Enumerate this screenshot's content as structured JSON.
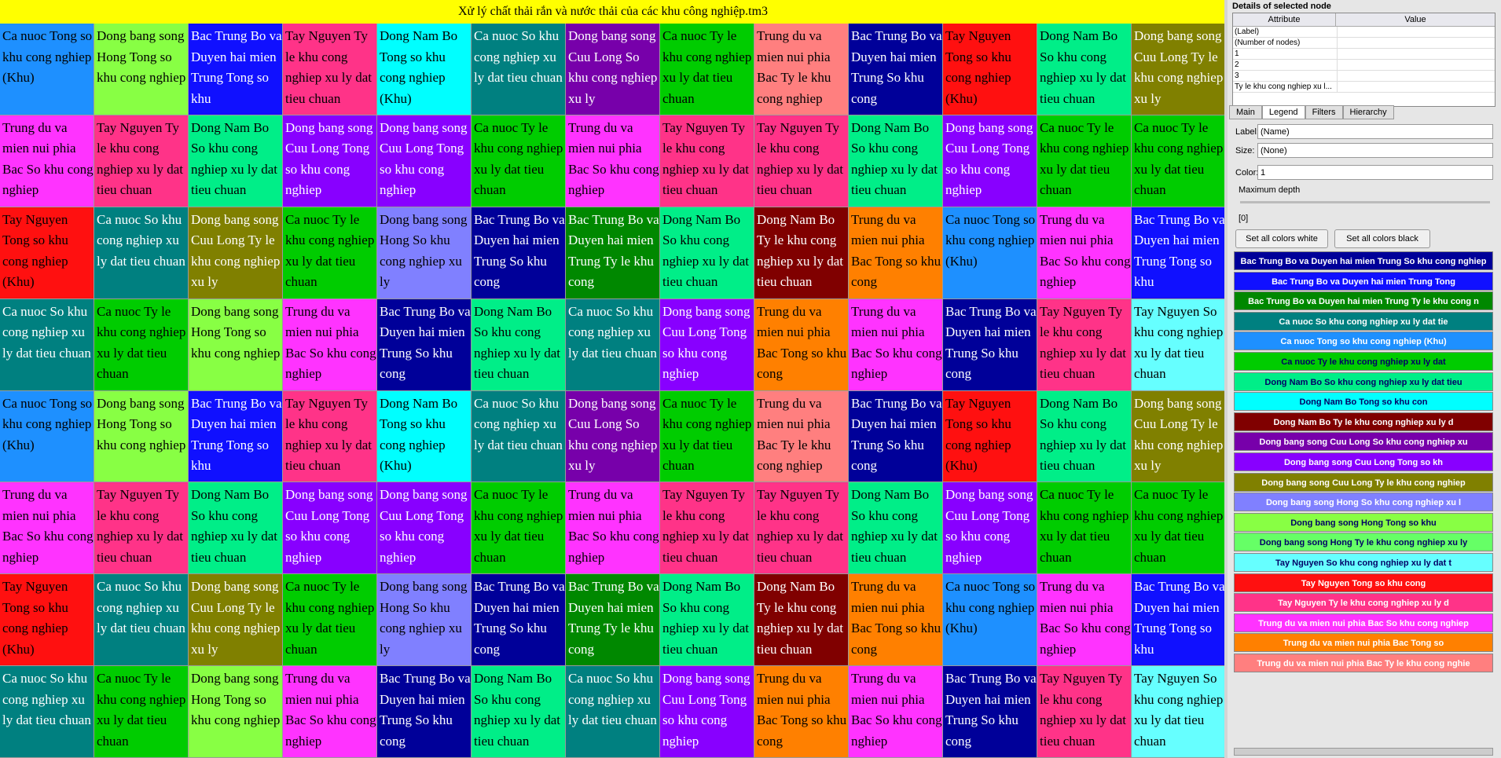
{
  "window": {
    "title": "Xử lý chất thải rắn và nước thải của các khu công nghiệp.tm3"
  },
  "treemap": {
    "tiles": [
      {
        "label": "Ca nuoc Tong so khu cong nghiep (Khu)",
        "color": "#1e90ff"
      },
      {
        "label": "Ca nuoc Ty le khu cong nghiep xu ly dat tieu chuan",
        "color": "#00cc00"
      },
      {
        "label": "Dong bang song Hong So khu cong nghiep xu ly",
        "color": "#8080ff"
      },
      {
        "label": "Dong bang song Hong Tong so khu cong nghiep",
        "color": "#88ff44"
      },
      {
        "label": "Trung du va mien nui phia Bac Ty le khu cong nghiep",
        "color": "#ff7f7f"
      },
      {
        "label": "Trung du va mien nui phia Bac So khu cong nghiep",
        "color": "#ff33ff"
      },
      {
        "label": "Bac Trung Bo va Duyen hai mien Trung Tong so khu",
        "color": "#1010ff"
      },
      {
        "label": "Bac Trung Bo va Duyen hai mien Trung So khu cong",
        "color": "#000099"
      },
      {
        "label": "Bac Trung Bo va Duyen hai mien Trung Ty le khu cong",
        "color": "#008800"
      },
      {
        "label": "Tay Nguyen Ty le khu cong nghiep xu ly dat tieu chuan",
        "color": "#ff3388"
      },
      {
        "label": "Tay Nguyen Tong so khu cong nghiep (Khu)",
        "color": "#ff1010"
      },
      {
        "label": "Tay Nguyen So khu cong nghiep xu ly dat tieu chuan",
        "color": "#66ffff"
      },
      {
        "label": "Dong Nam Bo Tong so khu cong nghiep (Khu)",
        "color": "#00ffff"
      },
      {
        "label": "Dong Nam Bo So khu cong nghiep xu ly dat tieu chuan",
        "color": "#00ee88"
      },
      {
        "label": "Dong Nam Bo Ty le khu cong nghiep xu ly dat tieu chuan",
        "color": "#800000"
      },
      {
        "label": "Ca nuoc So khu cong nghiep xu ly dat tieu chuan",
        "color": "#008080"
      },
      {
        "label": "Dong bang song Cuu Long Ty le khu cong nghiep xu ly",
        "color": "#808000"
      },
      {
        "label": "Dong bang song Cuu Long Tong so khu cong nghiep",
        "color": "#8800ff"
      },
      {
        "label": "Dong bang song Cuu Long So khu cong nghiep xu ly",
        "color": "#7700aa"
      },
      {
        "label": "Trung du va mien nui phia Bac Tong so khu cong",
        "color": "#ff8000"
      }
    ]
  },
  "details": {
    "title": "Details of selected node",
    "col_attribute": "Attribute",
    "col_value": "Value",
    "rows": [
      "(Label)",
      "(Number of nodes)",
      "1",
      "2",
      "3",
      "Ty le khu cong nghiep xu l..."
    ]
  },
  "tabs": [
    "Main",
    "Legend",
    "Filters",
    "Hierarchy"
  ],
  "legend": {
    "label_caption": "Label:",
    "label_value": "(Name)",
    "size_caption": "Size:",
    "size_value": "(None)",
    "color_caption": "Color:",
    "color_value": "1",
    "max_depth_caption": "Maximum depth",
    "max_depth_value": "[0]",
    "btn_white": "Set all colors white",
    "btn_black": "Set all colors black",
    "entries": [
      {
        "label": "Bac Trung Bo va Duyen hai mien Trung So khu cong nghiep",
        "color": "#000099"
      },
      {
        "label": "Bac Trung Bo va Duyen hai mien Trung Tong",
        "color": "#1010ff"
      },
      {
        "label": "Bac Trung Bo va Duyen hai mien Trung Ty le khu cong n",
        "color": "#008800"
      },
      {
        "label": "Ca nuoc So khu cong nghiep xu ly dat tie",
        "color": "#008080"
      },
      {
        "label": "Ca nuoc Tong so khu cong nghiep (Khu)",
        "color": "#1e90ff"
      },
      {
        "label": "Ca nuoc Ty le khu cong nghiep xu ly dat",
        "color": "#00cc00"
      },
      {
        "label": "Dong Nam Bo So khu cong nghiep xu ly dat tieu",
        "color": "#00ee88"
      },
      {
        "label": "Dong Nam Bo Tong so khu con",
        "color": "#00ffff"
      },
      {
        "label": "Dong Nam Bo Ty le khu cong nghiep xu ly d",
        "color": "#800000"
      },
      {
        "label": "Dong bang song Cuu Long So khu cong nghiep xu",
        "color": "#7700aa"
      },
      {
        "label": "Dong bang song Cuu Long Tong so kh",
        "color": "#8800ff"
      },
      {
        "label": "Dong bang song Cuu Long Ty le khu cong nghiep",
        "color": "#808000"
      },
      {
        "label": "Dong bang song Hong So khu cong nghiep xu l",
        "color": "#8080ff"
      },
      {
        "label": "Dong bang song Hong Tong so khu",
        "color": "#88ff44"
      },
      {
        "label": "Dong bang song Hong Ty le khu cong nghiep xu ly",
        "color": "#66ff66"
      },
      {
        "label": "Tay Nguyen So khu cong nghiep xu ly dat t",
        "color": "#66ffff"
      },
      {
        "label": "Tay Nguyen Tong so khu cong",
        "color": "#ff1010"
      },
      {
        "label": "Tay Nguyen Ty le khu cong nghiep xu ly d",
        "color": "#ff3388"
      },
      {
        "label": "Trung du va mien nui phia Bac So khu cong nghiep",
        "color": "#ff33ff"
      },
      {
        "label": "Trung du va mien nui phia Bac Tong so",
        "color": "#ff8000"
      },
      {
        "label": "Trung du va mien nui phia Bac Ty le khu cong nghie",
        "color": "#ff7f7f"
      }
    ]
  }
}
